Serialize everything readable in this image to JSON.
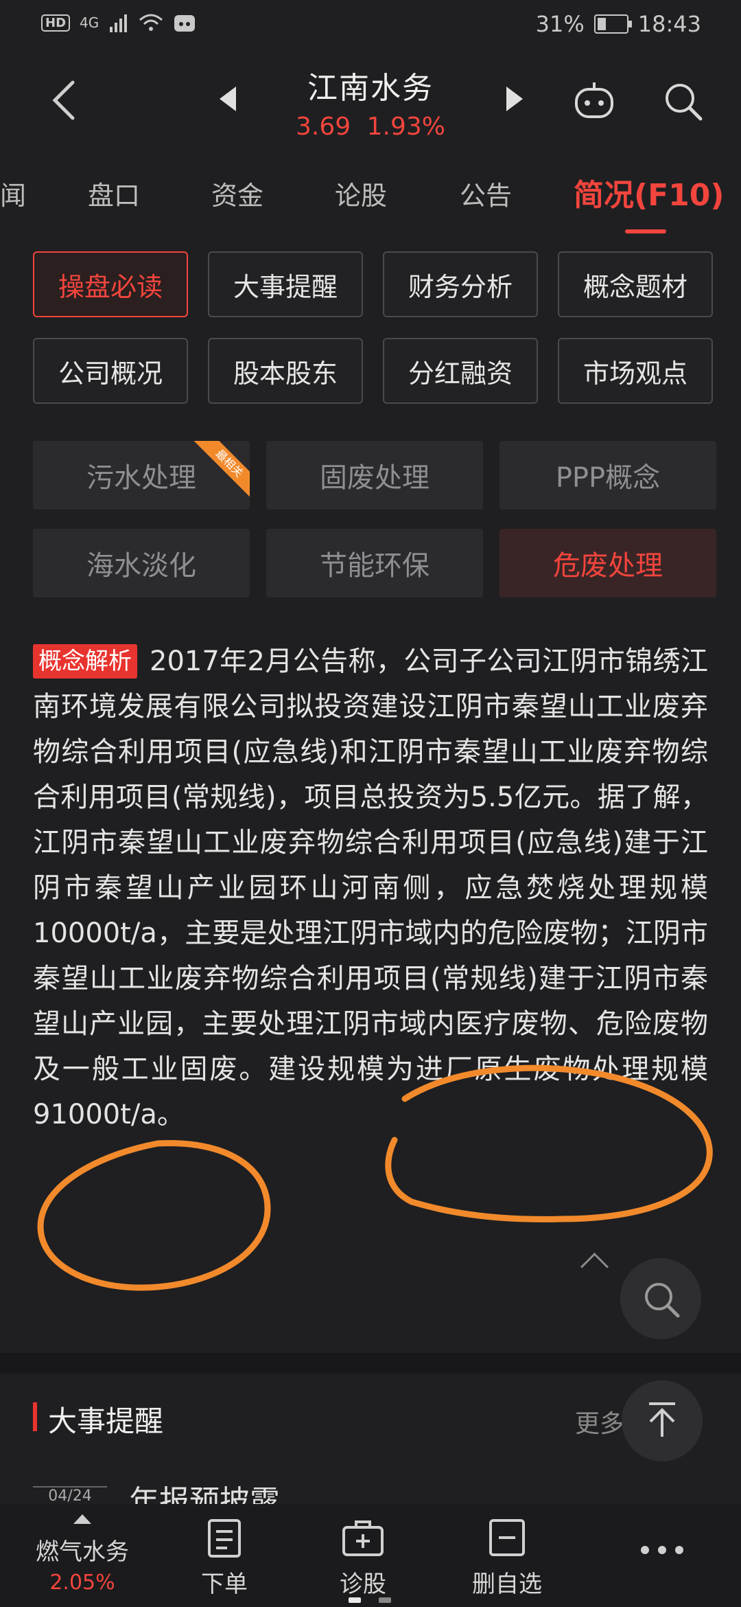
{
  "status_bar": {
    "network_badge": "HD",
    "network_type": "4G",
    "battery_percent": "31%",
    "battery_level": 0.31,
    "time": "18:43"
  },
  "header": {
    "title": "江南水务",
    "price": "3.69",
    "change_pct": "1.93%",
    "accent_color": "#f2453d"
  },
  "tabs": [
    {
      "label": "闻"
    },
    {
      "label": "盘口"
    },
    {
      "label": "资金"
    },
    {
      "label": "论股"
    },
    {
      "label": "公告"
    },
    {
      "label": "简况(F10)"
    }
  ],
  "quick_buttons": [
    {
      "label": "操盘必读"
    },
    {
      "label": "大事提醒"
    },
    {
      "label": "财务分析"
    },
    {
      "label": "概念题材"
    },
    {
      "label": "公司概况"
    },
    {
      "label": "股本股东"
    },
    {
      "label": "分红融资"
    },
    {
      "label": "市场观点"
    }
  ],
  "concepts": [
    {
      "label": "污水处理",
      "ribbon": "最相关"
    },
    {
      "label": "固废处理"
    },
    {
      "label": "PPP概念"
    },
    {
      "label": "海水淡化"
    },
    {
      "label": "节能环保"
    },
    {
      "label": "危废处理"
    }
  ],
  "analysis": {
    "tag": "概念解析",
    "text": "2017年2月公告称，公司子公司江阴市锦绣江南环境发展有限公司拟投资建设江阴市秦望山工业废弃物综合利用项目(应急线)和江阴市秦望山工业废弃物综合利用项目(常规线)，项目总投资为5.5亿元。据了解，江阴市秦望山工业废弃物综合利用项目(应急线)建于江阴市秦望山产业园环山河南侧，应急焚烧处理规模10000t/a，主要是处理江阴市域内的危险废物；江阴市秦望山工业废弃物综合利用项目(常规线)建于江阴市秦望山产业园，主要处理江阴市域内医疗废物、危险废物及一般工业固废。建设规模为进厂原生废物处理规模91000t/a。"
  },
  "section": {
    "title": "大事提醒",
    "more": "更多",
    "peek_date": "04/24",
    "peek_title": "年报预披露"
  },
  "bottom_bar": {
    "stock_name": "燃气水务",
    "stock_change": "2.05%",
    "order": "下单",
    "diagnose": "诊股",
    "remove": "删自选"
  }
}
